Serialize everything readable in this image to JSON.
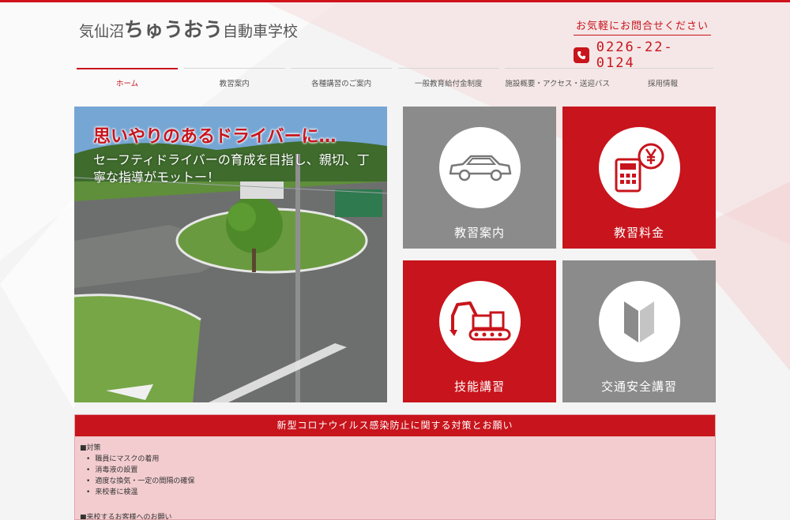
{
  "header": {
    "logo_a": "気仙沼",
    "logo_b": "ちゅうおう",
    "logo_c": "自動車学校",
    "contact_label": "お気軽にお問合せください",
    "phone": "0226-22-0124",
    "accent_color": "#c8141c"
  },
  "nav": {
    "items": [
      "ホーム",
      "教習案内",
      "各種講習のご案内",
      "一般教育給付金制度",
      "施設概要・アクセス・送迎バス",
      "採用情報"
    ],
    "active_index": 0
  },
  "hero": {
    "title": "思いやりのあるドライバーに…",
    "subtitle": "セーフティドライバーの育成を目指し、親切、丁寧な指導がモットー！"
  },
  "tiles": [
    {
      "label": "教習案内",
      "icon": "car-icon",
      "color": "gray"
    },
    {
      "label": "教習料金",
      "icon": "calculator-yen-icon",
      "color": "red"
    },
    {
      "label": "技能講習",
      "icon": "excavator-icon",
      "color": "red"
    },
    {
      "label": "交通安全講習",
      "icon": "beginner-mark-icon",
      "color": "gray"
    }
  ],
  "notice": {
    "title": "新型コロナウイルス感染防止に関する対策とお願い",
    "section1_heading": "■対策",
    "section1_items": [
      "職員にマスクの着用",
      "消毒液の設置",
      "適度な換気・一定の間隔の確保",
      "来校者に検温"
    ],
    "section2_heading": "■来校するお客様へのお願い"
  }
}
